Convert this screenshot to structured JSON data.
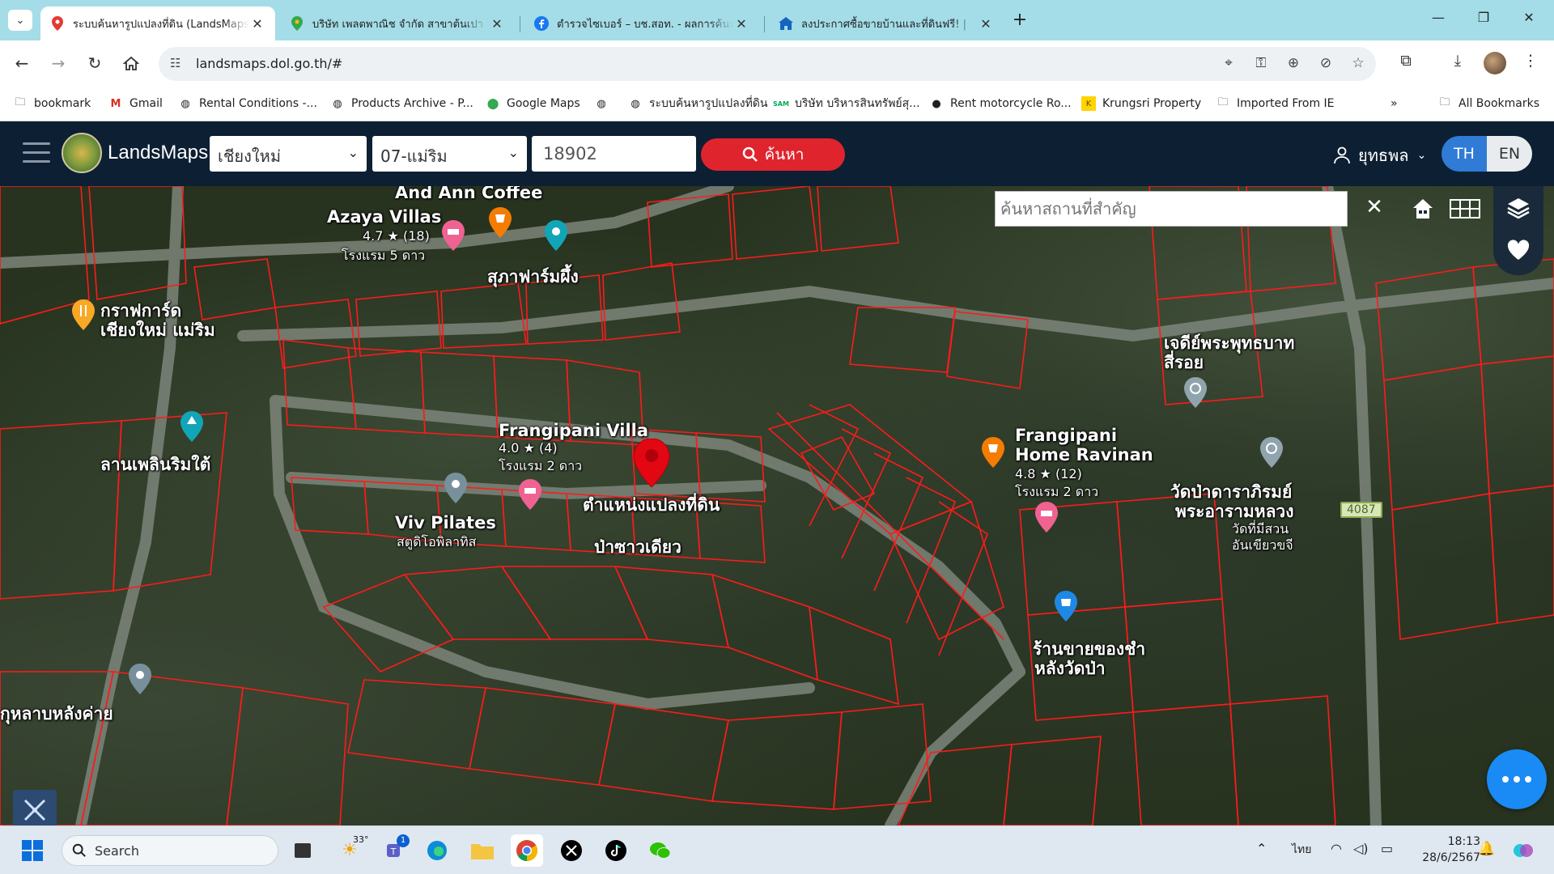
{
  "browser": {
    "tabs": [
      {
        "title": "ระบบค้นหารูปแปลงที่ดิน (LandsMaps)",
        "favicon": "map-pin-icon",
        "active": true
      },
      {
        "title": "บริษัท เพลตพาณิช จำกัด สาขาต้นเปา",
        "favicon": "google-maps-icon",
        "active": false
      },
      {
        "title": "ตำรวจไซเบอร์ – บช.สอท. - ผลการค้นหา",
        "favicon": "facebook-icon",
        "active": false
      },
      {
        "title": "ลงประกาศซื้อขายบ้านและที่ดินฟรี! |",
        "favicon": "house-icon",
        "active": false
      }
    ],
    "url": "landsmaps.dol.go.th/#",
    "bookmarks": [
      {
        "label": "bookmark",
        "icon": "folder-icon"
      },
      {
        "label": "Gmail",
        "icon": "gmail-icon"
      },
      {
        "label": "Rental Conditions -...",
        "icon": "globe-icon"
      },
      {
        "label": "Products Archive - P...",
        "icon": "globe-icon"
      },
      {
        "label": "Google Maps",
        "icon": "google-maps-icon"
      },
      {
        "label": "",
        "icon": "globe-icon"
      },
      {
        "label": "ระบบค้นหารูปแปลงที่ดิน",
        "icon": "globe-icon"
      },
      {
        "label": "บริษัท บริหารสินทรัพย์สุ...",
        "icon": "sam-icon"
      },
      {
        "label": "Rent motorcycle Ro...",
        "icon": "moto-icon"
      },
      {
        "label": "Krungsri Property",
        "icon": "krungsri-icon"
      },
      {
        "label": "Imported From IE",
        "icon": "folder-icon"
      }
    ],
    "all_bookmarks": "All Bookmarks"
  },
  "app": {
    "title": "LandsMaps",
    "province": "เชียงใหม่",
    "district": "07-แม่ริม",
    "parcel_number": "18902",
    "search_label": "ค้นหา",
    "user": "ยุทธพล",
    "lang_th": "TH",
    "lang_en": "EN",
    "place_search_placeholder": "ค้นหาสถานที่สำคัญ"
  },
  "map": {
    "labels": {
      "and_ann": "And Ann Coffee",
      "azaya": "Azaya Villas",
      "azaya_rating": "4.7 ★ (18)",
      "azaya_type": "โรงแรม 5 ดาว",
      "supha": "สุภาฟาร์มผึ้ง",
      "graph1": "กราฟการ์ด",
      "graph2": "เชียงใหม่ แม่ริม",
      "lan1": "ลานเพลินริมใต้",
      "frangi": "Frangipani Villa",
      "frangi_rating": "4.0 ★ (4)",
      "frangi_type": "โรงแรม 2 ดาว",
      "parcel_pos": "ตำแหน่งแปลงที่ดิน",
      "viv": "Viv Pilates",
      "viv_sub": "สตูดิโอพิลาทิส",
      "pasao": "ป่าซาวเดียว",
      "chedi1": "เจดีย์พระพุทธบาท",
      "chedi2": "สี่รอย",
      "home1": "Frangipani",
      "home2": "Home Ravinan",
      "home_rating": "4.8 ★ (12)",
      "home_type": "โรงแรม 2 ดาว",
      "wat1": "วัดป่าดาราภิรมย์",
      "wat2": "พระอารามหลวง",
      "wat3": "วัดที่มีสวน",
      "wat4": "อันเขียวขจี",
      "shop1": "ร้านขายของชำ",
      "shop2": "หลังวัดป่า",
      "kulab": "กุหลาบหลังค่าย",
      "road": "4087"
    }
  },
  "taskbar": {
    "search_placeholder": "Search",
    "weather": "33°",
    "teams_badge": "1",
    "lang": "ไทย",
    "time": "18:13",
    "date": "28/6/2567"
  },
  "colors": {
    "parcel_line": "#ff1a1a",
    "header_bg": "#0d1f33",
    "search_btn": "#e0242d",
    "lang_active": "#2f7bd6",
    "tabstrip": "#a4dde7"
  }
}
